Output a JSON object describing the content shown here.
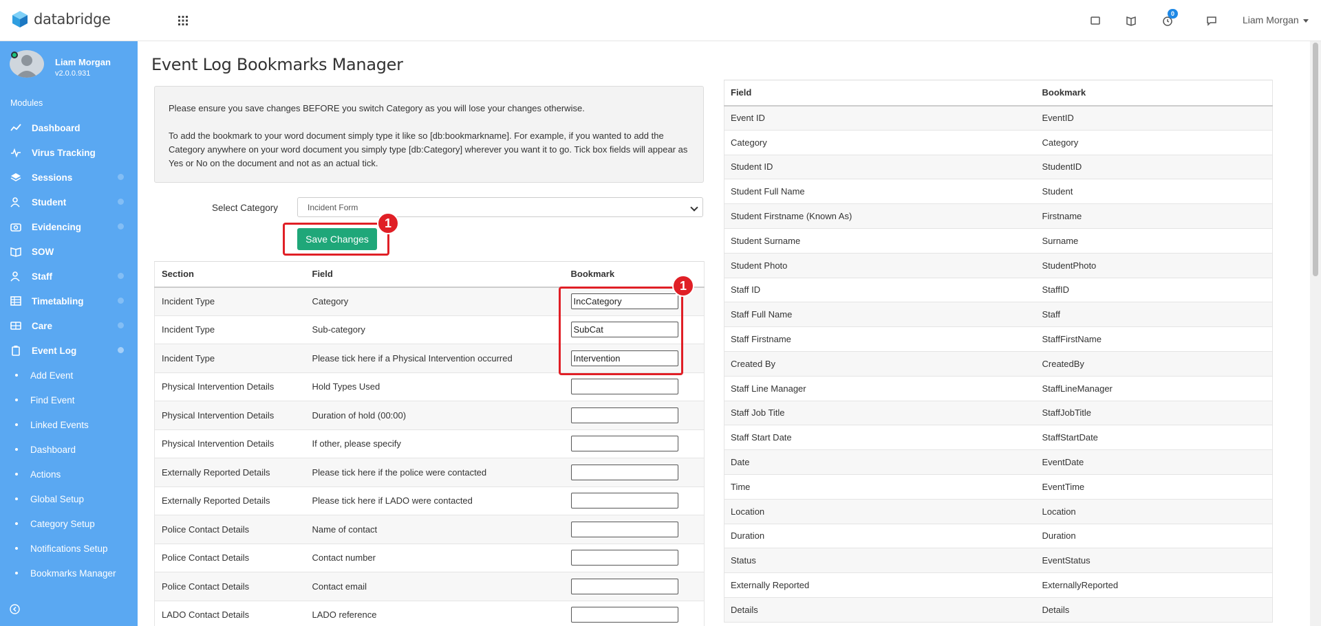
{
  "app": {
    "logo_text": "databridge"
  },
  "topbar": {
    "notification_count": "0",
    "user_name": "Liam Morgan",
    "icons": [
      "window-icon",
      "book-icon",
      "timer-icon",
      "chat-icon"
    ]
  },
  "sidebar": {
    "profile_name": "Liam Morgan",
    "version": "v2.0.0.931",
    "modules_heading": "Modules",
    "items": [
      {
        "label": "Dashboard",
        "icon": "chart-icon"
      },
      {
        "label": "Virus Tracking",
        "icon": "pulse-icon"
      },
      {
        "label": "Sessions",
        "icon": "layers-icon"
      },
      {
        "label": "Student",
        "icon": "users-icon"
      },
      {
        "label": "Evidencing",
        "icon": "camera-icon"
      },
      {
        "label": "SOW",
        "icon": "book-open-icon"
      },
      {
        "label": "Staff",
        "icon": "staff-icon"
      },
      {
        "label": "Timetabling",
        "icon": "grid-icon"
      },
      {
        "label": "Care",
        "icon": "card-icon"
      },
      {
        "label": "Event Log",
        "icon": "clipboard-icon"
      }
    ],
    "subitems": [
      "Add Event",
      "Find Event",
      "Linked Events",
      "Dashboard",
      "Actions",
      "Global Setup",
      "Category Setup",
      "Notifications Setup",
      "Bookmarks Manager"
    ]
  },
  "main": {
    "title": "Event Log Bookmarks Manager",
    "info_p1": "Please ensure you save changes BEFORE you switch Category as you will lose your changes otherwise.",
    "info_p2": "To add the bookmark to your word document simply type it like so [db:bookmarkname]. For example, if you wanted to add the Category anywhere on your word document you simply type [db:Category] wherever you want it to go. Tick box fields will appear as Yes or No on the document and not as an actual tick.",
    "select_label": "Select Category",
    "selected_category": "Incident Form",
    "save_label": "Save Changes",
    "annotation_1": "1",
    "annotation_2": "1",
    "left_table": {
      "headers": [
        "Section",
        "Field",
        "Bookmark"
      ],
      "rows": [
        {
          "section": "Incident Type",
          "field": "Category",
          "bookmark": "IncCategory"
        },
        {
          "section": "Incident Type",
          "field": "Sub-category",
          "bookmark": "SubCat"
        },
        {
          "section": "Incident Type",
          "field": "Please tick here if a Physical Intervention occurred",
          "bookmark": "Intervention"
        },
        {
          "section": "Physical Intervention Details",
          "field": "Hold Types Used",
          "bookmark": ""
        },
        {
          "section": "Physical Intervention Details",
          "field": "Duration of hold (00:00)",
          "bookmark": ""
        },
        {
          "section": "Physical Intervention Details",
          "field": "If other, please specify",
          "bookmark": ""
        },
        {
          "section": "Externally Reported Details",
          "field": "Please tick here if the police were contacted",
          "bookmark": ""
        },
        {
          "section": "Externally Reported Details",
          "field": "Please tick here if LADO were contacted",
          "bookmark": ""
        },
        {
          "section": "Police Contact Details",
          "field": "Name of contact",
          "bookmark": ""
        },
        {
          "section": "Police Contact Details",
          "field": "Contact number",
          "bookmark": ""
        },
        {
          "section": "Police Contact Details",
          "field": "Contact email",
          "bookmark": ""
        },
        {
          "section": "LADO Contact Details",
          "field": "LADO reference",
          "bookmark": ""
        }
      ]
    },
    "right_table": {
      "headers": [
        "Field",
        "Bookmark"
      ],
      "rows": [
        [
          "Event ID",
          "EventID"
        ],
        [
          "Category",
          "Category"
        ],
        [
          "Student ID",
          "StudentID"
        ],
        [
          "Student Full Name",
          "Student"
        ],
        [
          "Student Firstname (Known As)",
          "Firstname"
        ],
        [
          "Student Surname",
          "Surname"
        ],
        [
          "Student Photo",
          "StudentPhoto"
        ],
        [
          "Staff ID",
          "StaffID"
        ],
        [
          "Staff Full Name",
          "Staff"
        ],
        [
          "Staff Firstname",
          "StaffFirstName"
        ],
        [
          "Created By",
          "CreatedBy"
        ],
        [
          "Staff Line Manager",
          "StaffLineManager"
        ],
        [
          "Staff Job Title",
          "StaffJobTitle"
        ],
        [
          "Staff Start Date",
          "StaffStartDate"
        ],
        [
          "Date",
          "EventDate"
        ],
        [
          "Time",
          "EventTime"
        ],
        [
          "Location",
          "Location"
        ],
        [
          "Duration",
          "Duration"
        ],
        [
          "Status",
          "EventStatus"
        ],
        [
          "Externally Reported",
          "ExternallyReported"
        ],
        [
          "Details",
          "Details"
        ]
      ]
    }
  },
  "colors": {
    "sidebar": "#5aa8f2",
    "save_button": "#1fa779",
    "annotation": "#e01f26",
    "badge": "#1e88e5"
  }
}
